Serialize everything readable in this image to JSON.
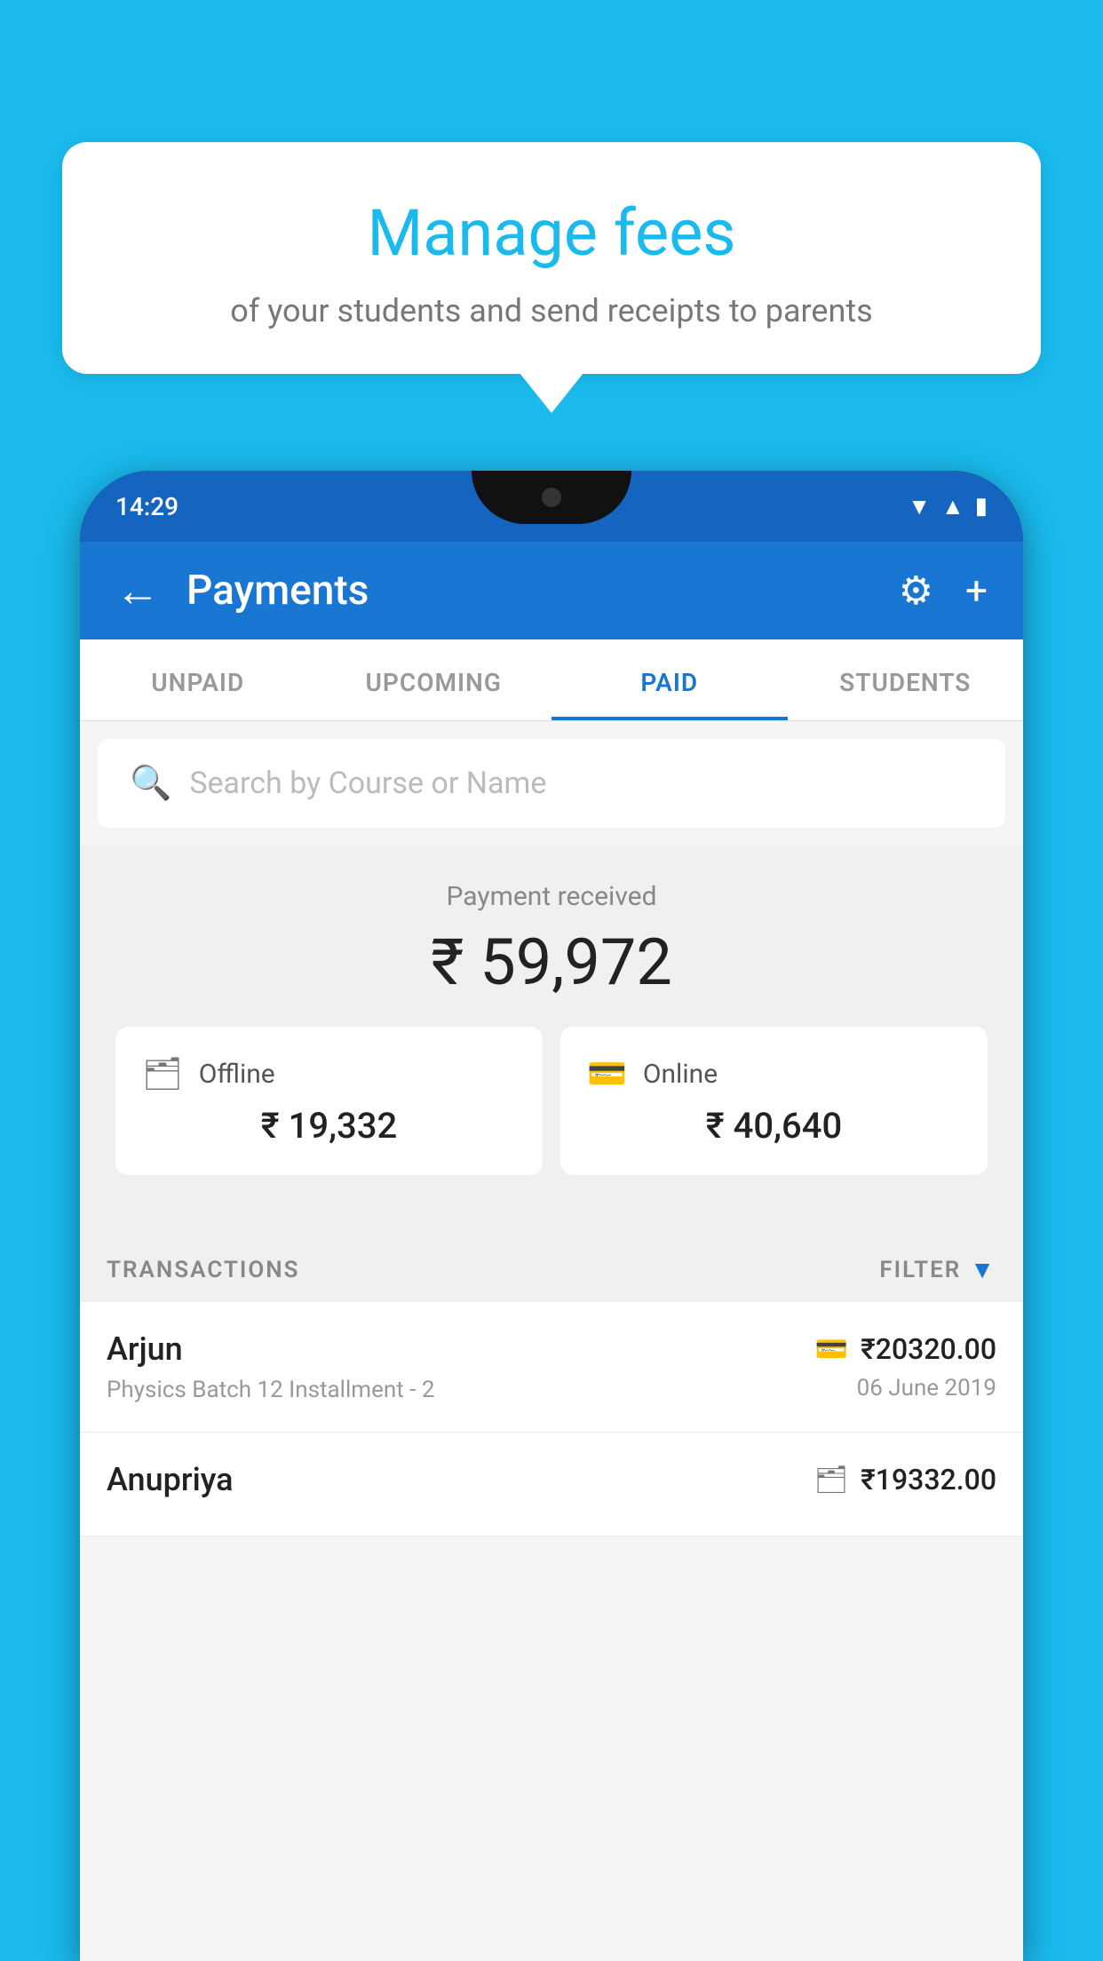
{
  "background_color": "#1ABAED",
  "speech_bubble": {
    "title": "Manage fees",
    "subtitle": "of your students and send receipts to parents"
  },
  "phone": {
    "status_bar": {
      "time": "14:29",
      "icons": [
        "wifi",
        "signal",
        "battery"
      ]
    },
    "header": {
      "back_label": "←",
      "title": "Payments",
      "gear_icon": "⚙",
      "plus_icon": "+"
    },
    "tabs": [
      {
        "label": "UNPAID",
        "active": false
      },
      {
        "label": "UPCOMING",
        "active": false
      },
      {
        "label": "PAID",
        "active": true
      },
      {
        "label": "STUDENTS",
        "active": false
      }
    ],
    "search": {
      "placeholder": "Search by Course or Name"
    },
    "payment_summary": {
      "label": "Payment received",
      "amount": "₹ 59,972",
      "offline": {
        "label": "Offline",
        "amount": "₹ 19,332"
      },
      "online": {
        "label": "Online",
        "amount": "₹ 40,640"
      }
    },
    "transactions_label": "TRANSACTIONS",
    "filter_label": "FILTER",
    "transactions": [
      {
        "name": "Arjun",
        "detail": "Physics Batch 12 Installment - 2",
        "amount": "₹20320.00",
        "date": "06 June 2019",
        "payment_type": "card"
      },
      {
        "name": "Anupriya",
        "detail": "",
        "amount": "₹19332.00",
        "date": "",
        "payment_type": "offline"
      }
    ]
  }
}
